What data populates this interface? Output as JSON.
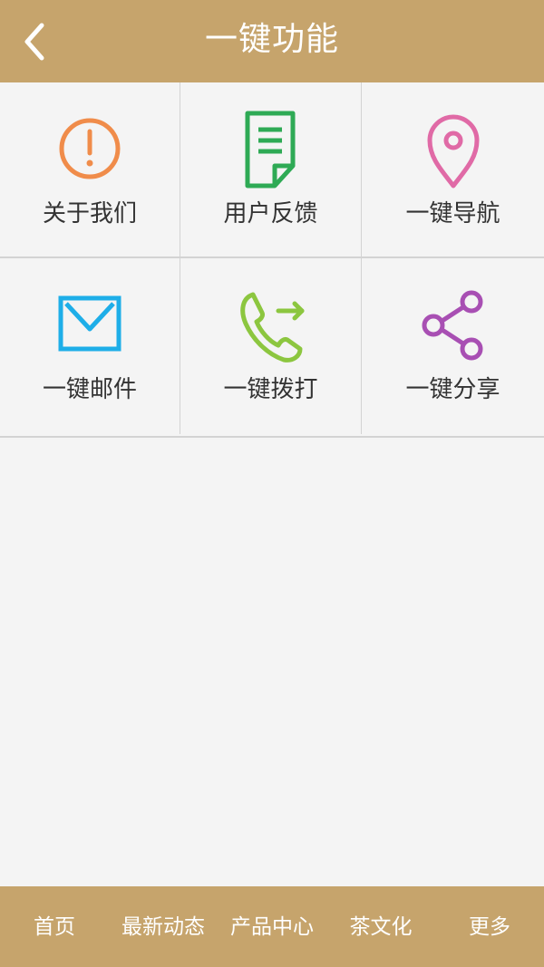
{
  "header": {
    "title": "一键功能",
    "back_icon": "chevron-left-icon"
  },
  "colors": {
    "brand": "#c6a46c",
    "background": "#f4f4f4",
    "about_icon": "#f08c4a",
    "feedback_icon": "#2eaa55",
    "navigation_icon": "#e06aa6",
    "mail_icon": "#1eaee8",
    "call_icon": "#8cc63f",
    "share_icon": "#a84fb3"
  },
  "features": [
    {
      "label": "关于我们",
      "icon": "info-exclamation-icon"
    },
    {
      "label": "用户反馈",
      "icon": "document-icon"
    },
    {
      "label": "一键导航",
      "icon": "location-pin-icon"
    },
    {
      "label": "一键邮件",
      "icon": "mail-icon"
    },
    {
      "label": "一键拨打",
      "icon": "phone-call-icon"
    },
    {
      "label": "一键分享",
      "icon": "share-icon"
    }
  ],
  "tabbar": {
    "items": [
      {
        "label": "首页"
      },
      {
        "label": "最新动态"
      },
      {
        "label": "产品中心"
      },
      {
        "label": "茶文化"
      },
      {
        "label": "更多"
      }
    ]
  }
}
